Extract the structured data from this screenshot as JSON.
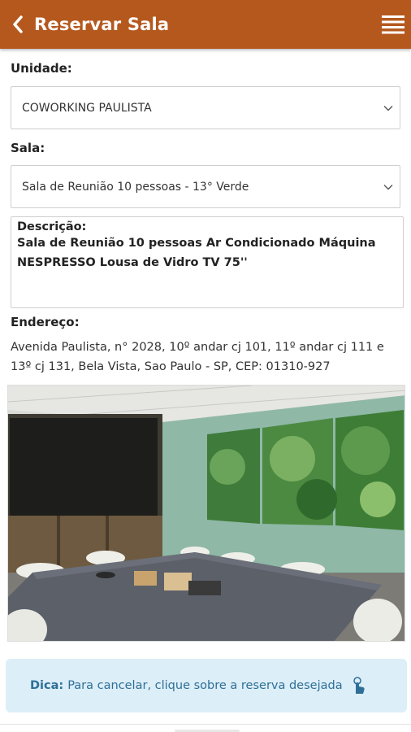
{
  "header": {
    "title": "Reservar Sala",
    "back_icon": "chevron-left-icon",
    "menu_icon": "hamburger-menu-icon",
    "color": "#b5581e"
  },
  "form": {
    "unidade_label": "Unidade:",
    "unidade_value": "COWORKING PAULISTA",
    "sala_label": "Sala:",
    "sala_value": "Sala de Reunião 10 pessoas - 13° Verde",
    "descricao_label": "Descrição:",
    "descricao_text": "Sala de Reunião 10 pessoas Ar Condicionado Máquina NESPRESSO Lousa de Vidro TV 75''",
    "endereco_label": "Endereço:",
    "endereco_text": "Avenida Paulista, n° 2028, 10º andar cj 101, 11º andar cj 111 e 13º cj 131, Bela Vista, Sao Paulo - SP, CEP: 01310-927"
  },
  "tip": {
    "label": "Dica:",
    "text": "Para cancelar, clique sobre a reserva desejada",
    "icon": "tap-hand-icon",
    "background": "#dceef8"
  }
}
